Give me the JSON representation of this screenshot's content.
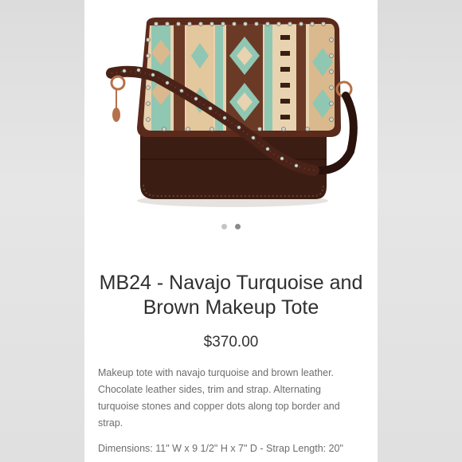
{
  "product": {
    "title": "MB24 - Navajo Turquoise and Brown Makeup Tote",
    "price": "$370.00",
    "description": "Makeup tote with navajo turquoise and brown leather. Chocolate leather sides, trim and strap. Alternating turquoise stones and copper dots along top border and strap.",
    "dimensions": "Dimensions: 11\" W x 9 1/2\" H x 7\" D - Strap Length: 20\""
  },
  "gallery": {
    "image_count": 2,
    "active_index": 1,
    "image_alt": "Navajo turquoise and brown leather makeup tote"
  },
  "colors": {
    "leather_brown": "#3b1d14",
    "trim_brown": "#5a2a1c",
    "turquoise": "#8fc7b3",
    "cream": "#e8d3b0",
    "copper": "#b5714a",
    "title_text": "#2f2f2f",
    "body_text": "#6d6d6d"
  }
}
